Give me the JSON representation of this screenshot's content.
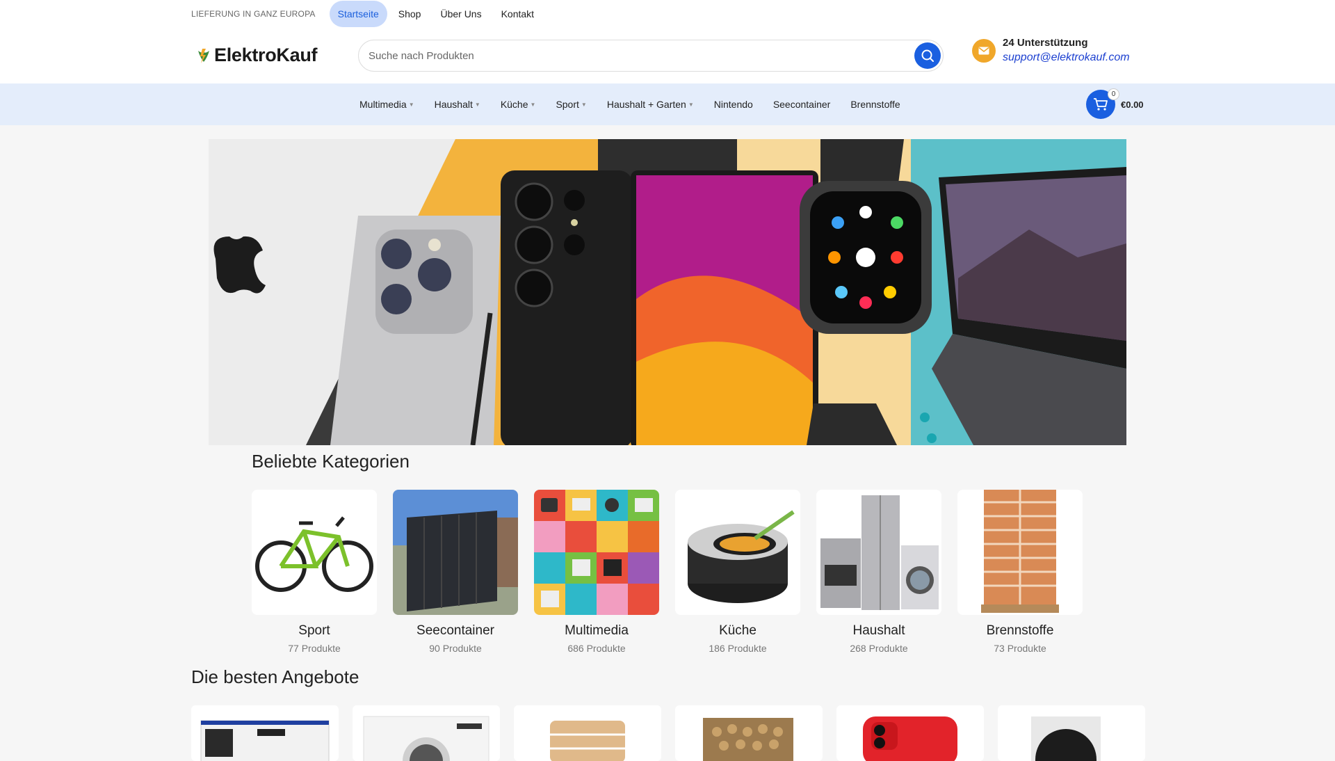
{
  "topbar": {
    "shipping": "LIEFERUNG IN GANZ EUROPA",
    "links": [
      "Startseite",
      "Shop",
      "Über Uns",
      "Kontakt"
    ]
  },
  "header": {
    "logo": "ElektroKauf",
    "search_placeholder": "Suche nach Produkten",
    "support_title": "24 Unterstützung",
    "support_email": "support@elektrokauf.com"
  },
  "nav": {
    "items": [
      {
        "label": "Multimedia",
        "has_dropdown": true
      },
      {
        "label": "Haushalt",
        "has_dropdown": true
      },
      {
        "label": "Küche",
        "has_dropdown": true
      },
      {
        "label": "Sport",
        "has_dropdown": true
      },
      {
        "label": "Haushalt + Garten",
        "has_dropdown": true
      },
      {
        "label": "Nintendo",
        "has_dropdown": false
      },
      {
        "label": "Seecontainer",
        "has_dropdown": false
      },
      {
        "label": "Brennstoffe",
        "has_dropdown": false
      }
    ],
    "cart_count": "0",
    "cart_total": "€0.00"
  },
  "categories": {
    "title": "Beliebte Kategorien",
    "items": [
      {
        "name": "Sport",
        "count": "77 Produkte"
      },
      {
        "name": "Seecontainer",
        "count": "90 Produkte"
      },
      {
        "name": "Multimedia",
        "count": "686 Produkte"
      },
      {
        "name": "Küche",
        "count": "186 Produkte"
      },
      {
        "name": "Haushalt",
        "count": "268 Produkte"
      },
      {
        "name": "Brennstoffe",
        "count": "73 Produkte"
      }
    ]
  },
  "deals": {
    "title": "Die besten Angebote"
  },
  "colors": {
    "accent": "#1a5fe0",
    "nav_bg": "#e4edfb",
    "support_icon": "#f0a72a",
    "active_pill": "#c9dafb"
  }
}
